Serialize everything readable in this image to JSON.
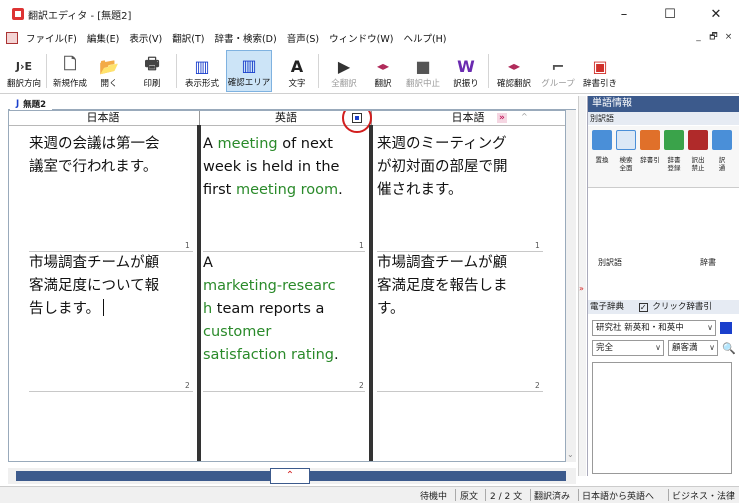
{
  "window": {
    "title": "翻訳エディタ - [無題2]",
    "controls": {
      "minimize": "–",
      "maximize": "☐",
      "close": "✕"
    }
  },
  "menubar": {
    "items": [
      "ファイル(F)",
      "編集(E)",
      "表示(V)",
      "翻訳(T)",
      "辞書・検索(D)",
      "音声(S)",
      "ウィンドウ(W)",
      "ヘルプ(H)"
    ],
    "mdi_controls": [
      "_",
      "🗗",
      "×"
    ]
  },
  "toolbar": {
    "buttons": [
      {
        "label": "翻訳方向",
        "glyph": "J›E",
        "enabled": true
      },
      {
        "label": "新規作成",
        "glyph": "🗋",
        "enabled": true
      },
      {
        "label": "開く",
        "glyph": "📂",
        "enabled": true
      },
      {
        "label": "印刷",
        "glyph": "🖶",
        "enabled": true
      },
      {
        "label": "表示形式",
        "glyph": "▥",
        "enabled": true
      },
      {
        "label": "確認エリア",
        "glyph": "▥",
        "enabled": true,
        "active": true
      },
      {
        "label": "文字",
        "glyph": "A",
        "enabled": true
      },
      {
        "label": "全翻訳",
        "glyph": "▶",
        "enabled": false
      },
      {
        "label": "翻訳",
        "glyph": "◂▸",
        "enabled": true
      },
      {
        "label": "翻訳中止",
        "glyph": "■",
        "enabled": false
      },
      {
        "label": "訳振り",
        "glyph": "W",
        "enabled": true
      },
      {
        "label": "確認翻訳",
        "glyph": "◂▸",
        "enabled": true
      },
      {
        "label": "グループ",
        "glyph": "⌐",
        "enabled": false
      },
      {
        "label": "辞書引き",
        "glyph": "▣",
        "enabled": true
      }
    ]
  },
  "document": {
    "tab_icon": "J",
    "tab_label": "無題2",
    "headers": [
      "日本語",
      "英語",
      "日本語"
    ],
    "rows": [
      {
        "number": "1",
        "source_lines": [
          "来週の会議は第一会",
          "議室で行われます。"
        ],
        "target_lines": [
          [
            {
              "t": "A ",
              "g": false
            },
            {
              "t": "meeting",
              "g": true
            },
            {
              "t": " of next",
              "g": false
            }
          ],
          [
            {
              "t": "week is held in the",
              "g": false
            }
          ],
          [
            {
              "t": "first ",
              "g": false
            },
            {
              "t": "meeting room",
              "g": true
            },
            {
              "t": ".",
              "g": false
            }
          ]
        ],
        "confirm_lines": [
          "来週のミーティング",
          "が初対面の部屋で開",
          "催されます。"
        ]
      },
      {
        "number": "2",
        "source_lines": [
          "市場調査チームが顧",
          "客満足度について報",
          "告します。"
        ],
        "target_lines": [
          [
            {
              "t": "A",
              "g": false
            }
          ],
          [
            {
              "t": "marketing-researc",
              "g": true
            }
          ],
          [
            {
              "t": "h",
              "g": true
            },
            {
              "t": " team reports a",
              "g": false
            }
          ],
          [
            {
              "t": "customer",
              "g": true
            }
          ],
          [
            {
              "t": "satisfaction rating",
              "g": true
            },
            {
              "t": ".",
              "g": false
            }
          ]
        ],
        "confirm_lines": [
          "市場調査チームが顧",
          "客満足度を報告しま",
          "す。"
        ]
      }
    ]
  },
  "right_panel": {
    "title": "単語情報",
    "subtitle": "別訳語",
    "icons": [
      {
        "label": "置換",
        "color": "#4a8fd8"
      },
      {
        "label": "検索\n全面",
        "color": "#5a9ad0"
      },
      {
        "label": "辞書引",
        "color": "#e0702a"
      },
      {
        "label": "辞書\n登録",
        "color": "#3aa34a"
      },
      {
        "label": "訳出\n禁止",
        "color": "#b02a2a"
      },
      {
        "label": "訳\n通",
        "color": "#4a8fd8"
      }
    ],
    "list_headers": [
      "別訳語",
      "辞書"
    ],
    "dict_title": "電子辞典",
    "dict_checkbox_label": "クリック辞書引",
    "dict_checkbox_checked": true,
    "dict_source": "研究社 新英和・和英中",
    "match_mode": "完全",
    "search_query": "顧客満"
  },
  "statusbar": {
    "items": [
      "待機中",
      "原文",
      "2 / 2 文",
      "翻訳済み",
      "日本語から英語へ",
      "ビジネス・法律"
    ]
  }
}
